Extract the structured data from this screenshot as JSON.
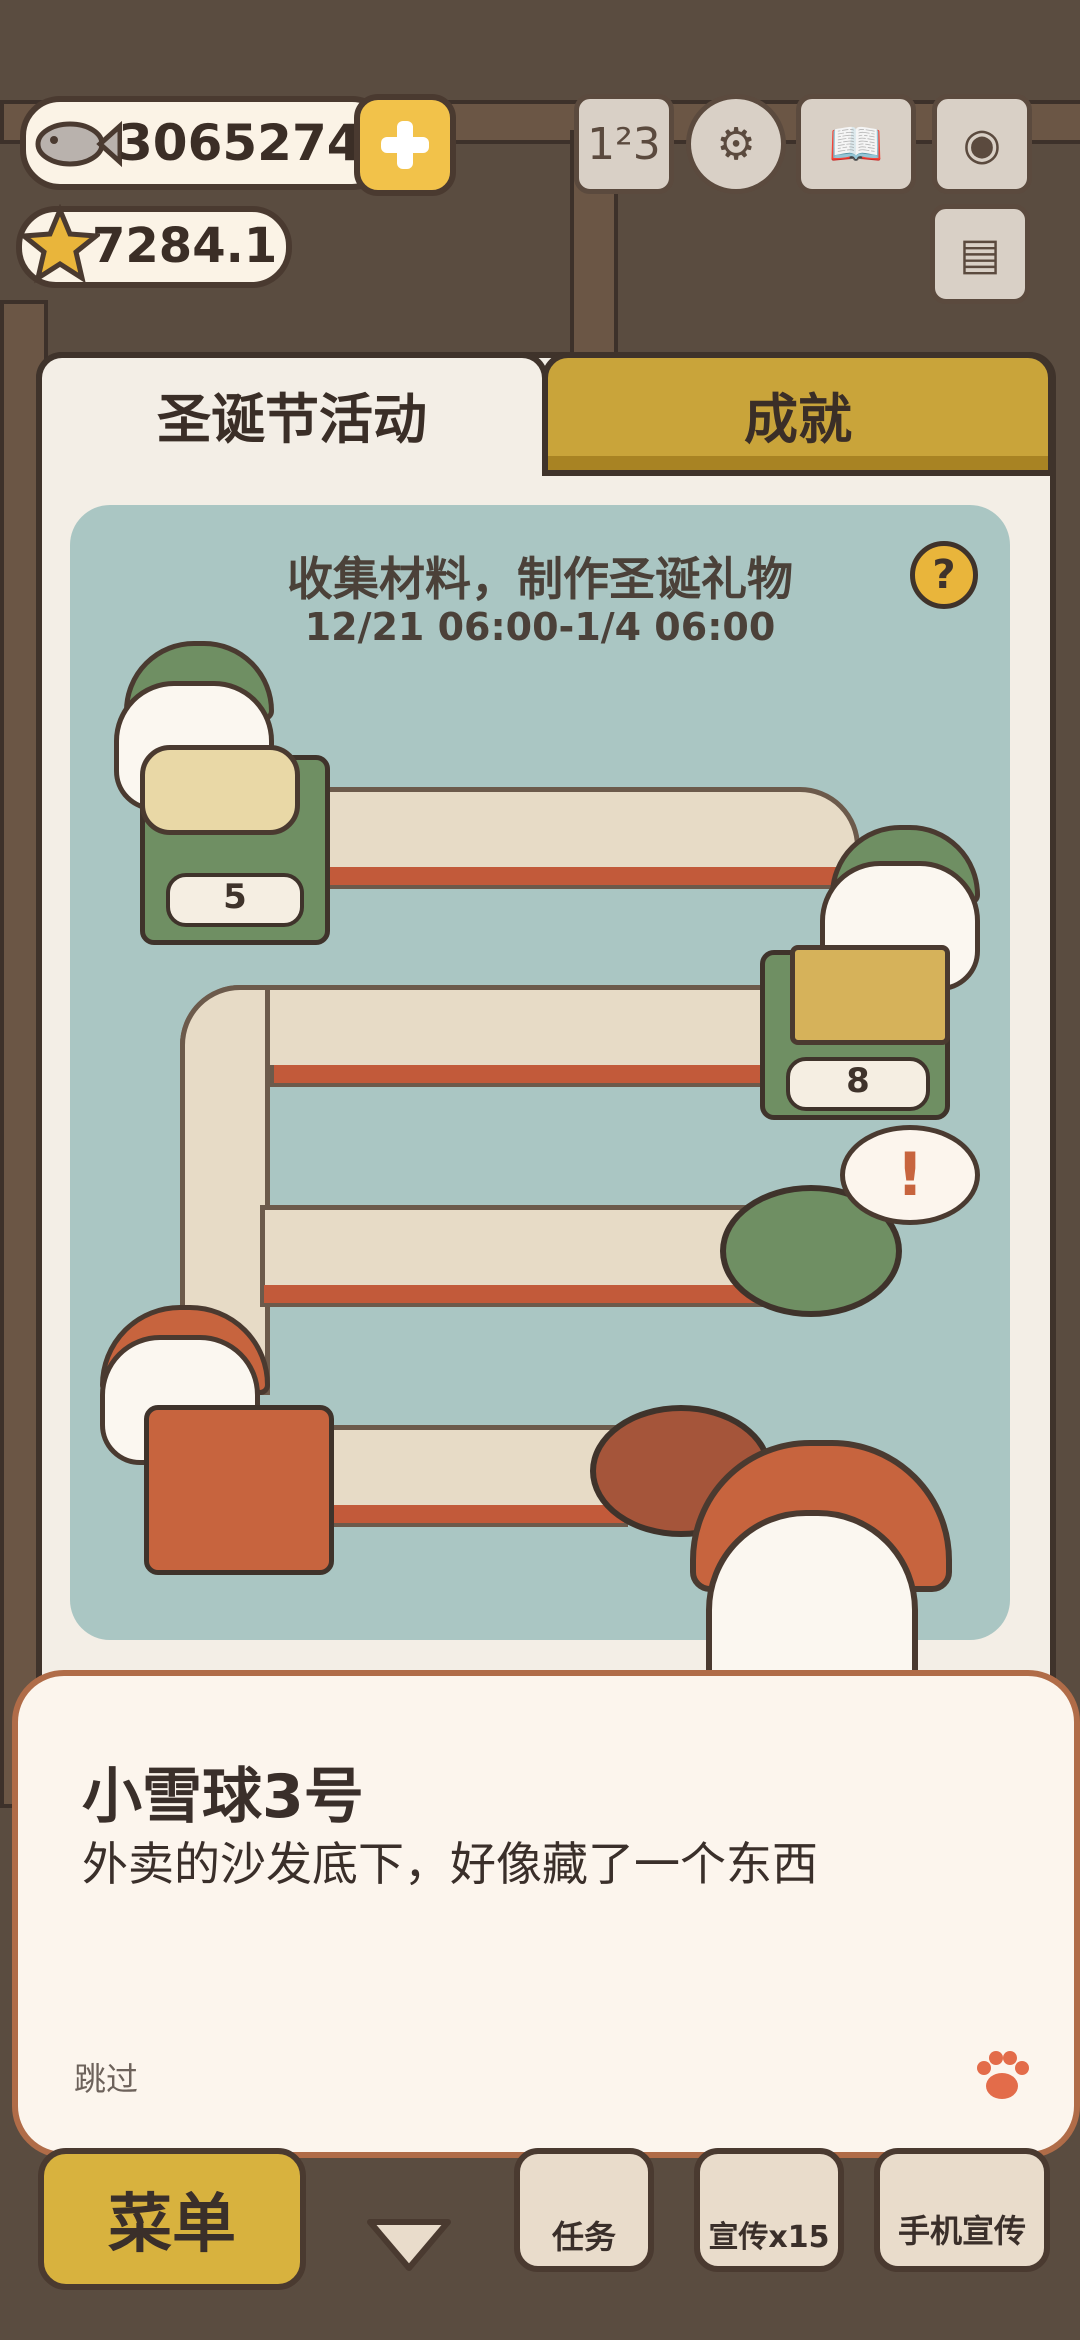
{
  "hud": {
    "fish_count": "3065274",
    "star_count": "7284.1",
    "add_icon": "plus-icon",
    "icons": [
      "ranking-icon",
      "settings-gear-icon",
      "book-icon",
      "camera-icon",
      "newspaper-icon"
    ]
  },
  "panel": {
    "tabs": [
      {
        "label": "圣诞节活动",
        "active": true
      },
      {
        "label": "成就",
        "active": false
      }
    ],
    "board": {
      "title": "收集材料，制作圣诞礼物",
      "date_range": "12/21 06:00-1/4 06:00",
      "help_label": "?",
      "stations": [
        {
          "item": "yarn-bundle",
          "count": "5"
        },
        {
          "item": "cardboard-box",
          "count": "8"
        }
      ],
      "alert_mark": "!"
    }
  },
  "dialog": {
    "speaker": "小雪球3号",
    "text": "外卖的沙发底下，好像藏了一个东西",
    "skip_label": "跳过",
    "advance_icon": "paw-icon"
  },
  "bottom_bar": {
    "menu_label": "菜单",
    "task_label": "任务",
    "promo_label": "宣传x15",
    "phone_promo_label": "手机宣传"
  },
  "colors": {
    "accent_gold": "#d8b23e",
    "board_teal": "#aac6c3",
    "dialog_border": "#b06c48",
    "paw_orange": "#e36c4a"
  }
}
